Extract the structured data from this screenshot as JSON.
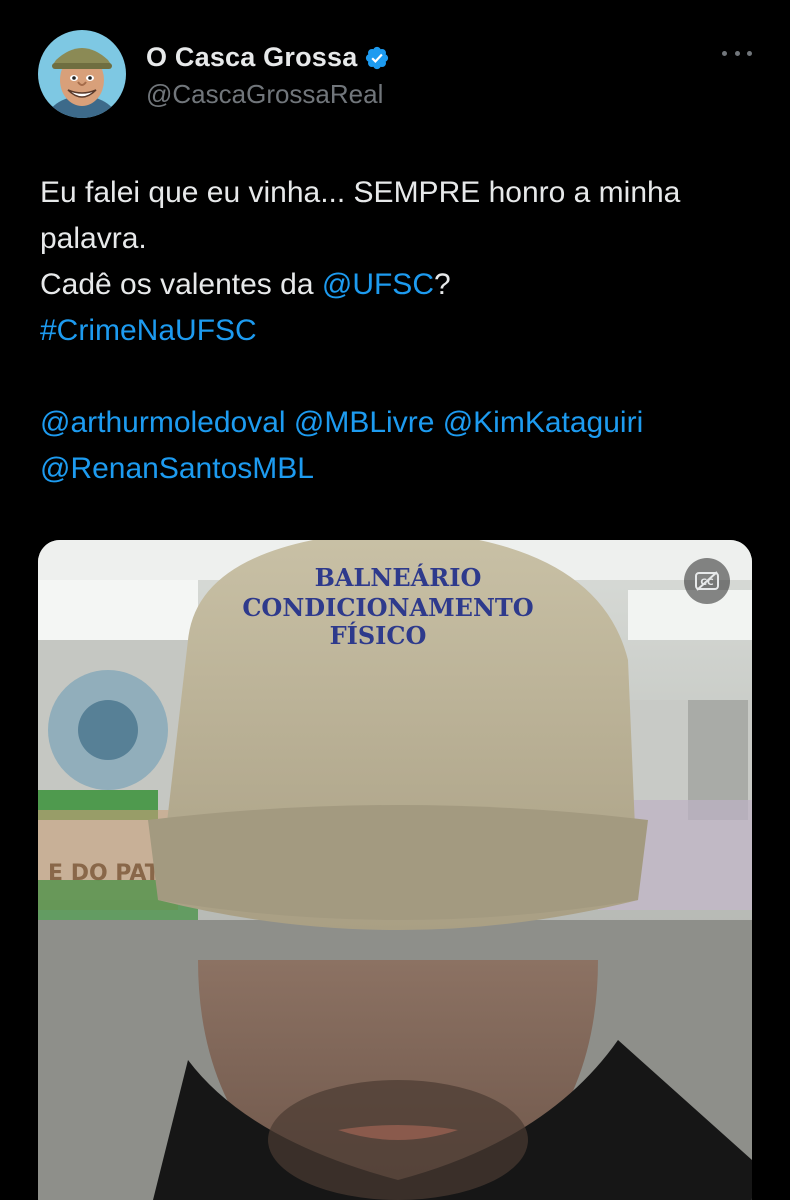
{
  "post": {
    "author": {
      "display_name": "O Casca Grossa",
      "handle": "@CascaGrossaReal",
      "verified": true,
      "avatar_icon": "avatar-cartoon-man-icon"
    },
    "text_lines": [
      {
        "plain": "Eu falei que eu vinha... SEMPRE honro a minha",
        "link": "",
        "after": ""
      },
      {
        "plain": "palavra.",
        "link": "",
        "after": ""
      },
      {
        "plain": "Cadê os valentes da ",
        "link": "@UFSC",
        "after": "?"
      },
      {
        "plain": "",
        "link": "#CrimeNaUFSC",
        "after": ""
      }
    ],
    "mention_lines": [
      "@arthurmoledoval @MBLivre @KimKataguiri",
      "@RenanSantosMBL"
    ],
    "media": {
      "type": "video",
      "cap_text_lines": [
        "BALNEÁRIO",
        "CONDICIONAMENTO",
        "FÍSICO"
      ],
      "background_text": "E DO PATO",
      "captions_icon": "captions-off-icon"
    }
  },
  "colors": {
    "background": "#000000",
    "text": "#e7e9ea",
    "secondary": "#71767b",
    "link": "#1d9bf0",
    "verified": "#1d9bf0"
  },
  "icons": {
    "verified": "verified-badge-icon",
    "more": "more-options-icon"
  }
}
